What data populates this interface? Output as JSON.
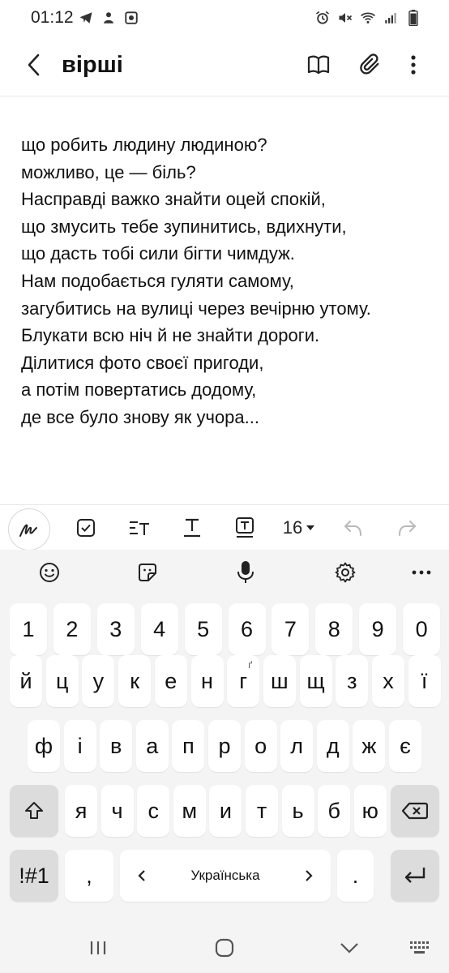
{
  "status_bar": {
    "time": "01:12"
  },
  "header": {
    "title": "вірші"
  },
  "note": {
    "lines": [
      "що робить людину людиною?",
      "можливо, це — біль?",
      "Насправді важко знайти оцей спокій,",
      "що змусить тебе зупинитись, вдихнути,",
      "що дасть тобі сили бігти чимдуж.",
      "Нам подобається гуляти самому,",
      "загубитись на вулиці через вечірню утому.",
      "Блукати всю ніч й не знайти дороги.",
      "Ділитися фото своєї пригоди,",
      "а потім повертатись додому,",
      "де все було знову як учора..."
    ]
  },
  "toolbar": {
    "font_size": "16"
  },
  "keyboard": {
    "row_numbers": [
      "1",
      "2",
      "3",
      "4",
      "5",
      "6",
      "7",
      "8",
      "9",
      "0"
    ],
    "row1": [
      "й",
      "ц",
      "у",
      "к",
      "е",
      "н",
      "г",
      "ш",
      "щ",
      "з",
      "х",
      "ї"
    ],
    "row1_superscript": {
      "г": "ґ"
    },
    "row2": [
      "ф",
      "і",
      "в",
      "а",
      "п",
      "р",
      "о",
      "л",
      "д",
      "ж",
      "є"
    ],
    "row3": [
      "я",
      "ч",
      "с",
      "м",
      "и",
      "т",
      "ь",
      "б",
      "ю"
    ],
    "symbols_label": "!#1",
    "comma_label": ",",
    "space_label": "Українська",
    "period_label": "."
  }
}
